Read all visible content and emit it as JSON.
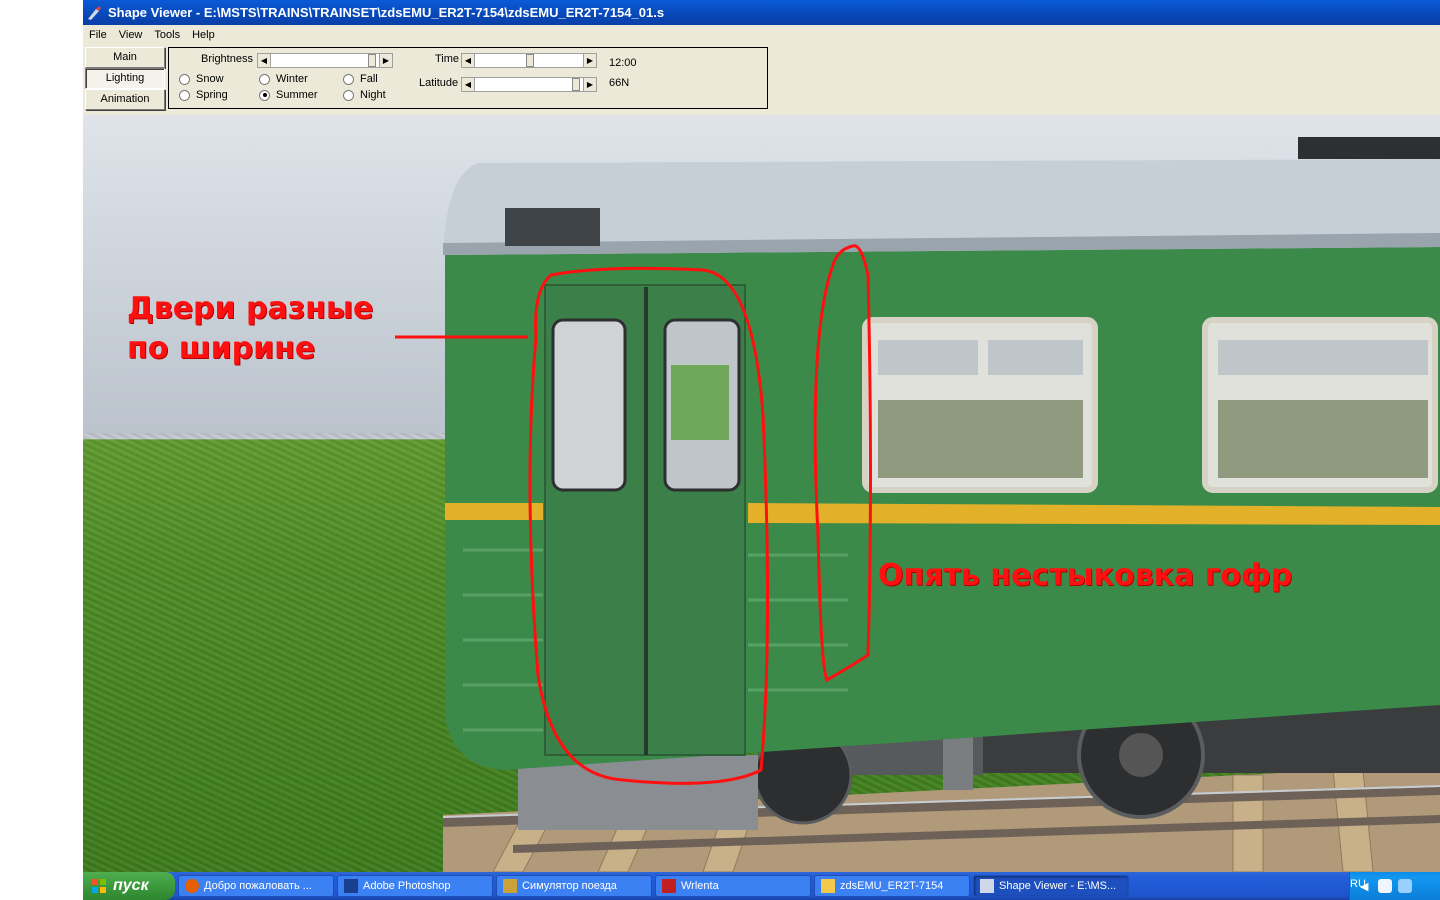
{
  "window": {
    "title": "Shape Viewer - E:\\MSTS\\TRAINS\\TRAINSET\\zdsEMU_ER2T-7154\\zdsEMU_ER2T-7154_01.s"
  },
  "menu": [
    "File",
    "View",
    "Tools",
    "Help"
  ],
  "modes": {
    "main": "Main",
    "lighting": "Lighting",
    "animation": "Animation",
    "active": "Lighting"
  },
  "lighting": {
    "brightness_label": "Brightness",
    "time_label": "Time",
    "time_value": "12:00",
    "latitude_label": "Latitude",
    "latitude_value": "66N",
    "seasons": {
      "snow": "Snow",
      "spring": "Spring",
      "winter": "Winter",
      "summer": "Summer",
      "fall": "Fall",
      "night": "Night"
    },
    "selected_season": "Summer"
  },
  "annotations": {
    "doors_line1": "Двери разные",
    "doors_line2": "по ширине",
    "gofr": "Опять нестыковка гофр",
    "color": "#ff1010"
  },
  "taskbar": {
    "start": "пуск",
    "tasks": [
      "Добро пожаловать ...",
      "Adobe Photoshop",
      "Симулятор поезда",
      "Wrlenta",
      "zdsEMU_ER2T-7154",
      "Shape Viewer - E:\\MS..."
    ],
    "language": "RU"
  },
  "colors": {
    "car_green": "#3b8a4a",
    "stripe_yellow": "#e3b02a",
    "xp_blue": "#245edb"
  }
}
